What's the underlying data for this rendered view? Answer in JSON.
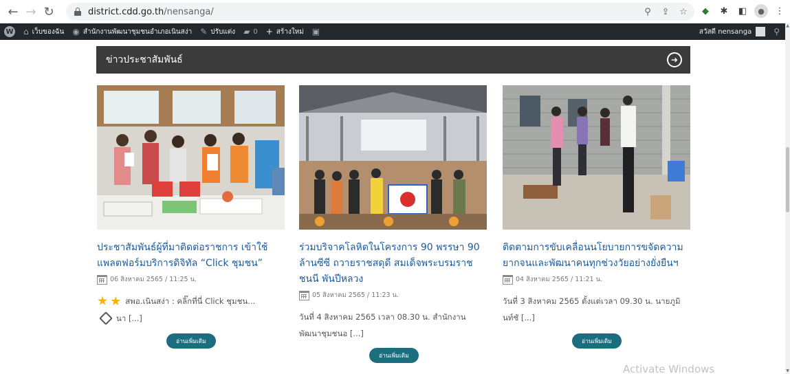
{
  "browser": {
    "url_domain": "district.cdd.go.th",
    "url_path": "/nensanga/"
  },
  "wp_admin_bar": {
    "my_site": "เว็บของฉัน",
    "site_name": "สำนักงานพัฒนาชุมชนอำเภอเนินสง่า",
    "customize": "ปรับแต่ง",
    "comments_count": "0",
    "new": "สร้างใหม่",
    "greeting": "สวัสดี nensanga"
  },
  "section": {
    "title": "ข่าวประชาสัมพันธ์"
  },
  "cards": [
    {
      "title": "ประชาสัมพันธ์ผู้ที่มาติดต่อราชการ เข้าใช้แพลตฟอร์มบริการดิจิทัล “Click ชุมชน”",
      "date": "06 สิงหาคม 2565 / 11:25 น.",
      "excerpt_1": "สพอ.เนินสง่า : คลิ๊กที่นี่ Click ชุมชน...",
      "excerpt_2": "นา [...]",
      "read_more": "อ่านเพิ่มเติม"
    },
    {
      "title": "ร่วมบริจาคโลหิตในโครงการ 90 พรรษา 90 ล้านซีซี ถวายราชสดุดี สมเด็จพระบรมราชชนนี พันปีหลวง",
      "date": "05 สิงหาคม 2565 / 11:23 น.",
      "excerpt": "วันที่ 4 สิงหาคม 2565 เวลา 08.30 น. สำนักงานพัฒนาชุมชนอ [...]",
      "read_more": "อ่านเพิ่มเติม"
    },
    {
      "title": "ติดตามการขับเคลื่อนนโยบายการขจัดความยากจนและพัฒนาคนทุกช่วงวัยอย่างยั่งยืนฯ",
      "date": "04 สิงหาคม 2565 / 11:21 น.",
      "excerpt": "วันที่ 3 สิงหาคม 2565 ตั้งแต่เวลา 09.30 น. นายภูมินท์ชั [...]",
      "read_more": "อ่านเพิ่มเติม"
    }
  ],
  "watermark": "Activate Windows",
  "icons": {
    "nav": [
      "back-icon",
      "forward-icon",
      "reload-icon"
    ],
    "omnibox": [
      "zoom-icon",
      "share-icon",
      "bookmark-star-icon"
    ],
    "extensions": [
      "gem-extension-icon",
      "puzzle-extension-icon",
      "side-panel-icon",
      "profile-avatar-icon",
      "menu-kebab-icon"
    ]
  },
  "colors": {
    "title_link": "#1a5a9e",
    "read_more_button": "#1a6e7e",
    "section_header_bg": "#3b3b3b",
    "wp_admin_bar_bg": "#23282d"
  }
}
